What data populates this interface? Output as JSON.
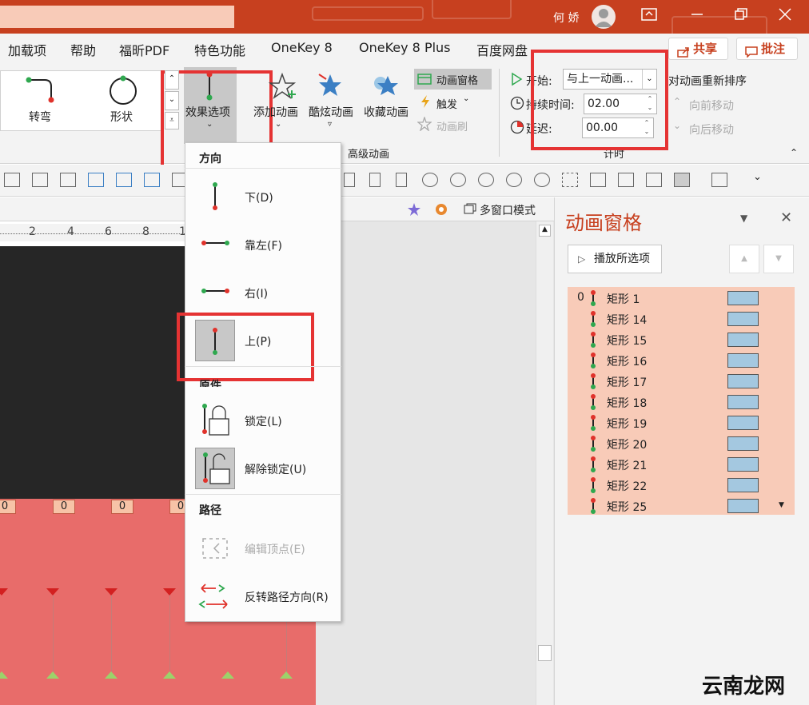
{
  "titlebar": {
    "user_name": "何 娇"
  },
  "menu": {
    "items": [
      "加载项",
      "帮助",
      "福昕PDF",
      "特色功能",
      "OneKey 8",
      "OneKey 8 Plus",
      "百度网盘"
    ],
    "share_label": "共享",
    "comment_label": "批注"
  },
  "ribbon": {
    "path_turn": "转弯",
    "path_shape": "形状",
    "effect_options": "效果选项",
    "add_animation": "添加动画",
    "cool_animation": "酷炫动画",
    "fav_animation": "收藏动画",
    "anim_pane": "动画窗格",
    "trigger": "触发",
    "anim_brush": "动画刷",
    "advanced_group": "高级动画",
    "start_label": "开始:",
    "start_value": "与上一动画...",
    "duration_label": "持续时间:",
    "duration_value": "02.00",
    "delay_label": "延迟:",
    "delay_value": "00.00",
    "reorder_title": "对动画重新排序",
    "move_earlier": "向前移动",
    "move_later": "向后移动",
    "timing_group": "计时"
  },
  "editor": {
    "multi_window": "多窗口模式",
    "ruler_labels": [
      "2",
      "4",
      "6",
      "8",
      "1"
    ],
    "zero_labels": [
      "0",
      "0",
      "0",
      "0",
      "0"
    ]
  },
  "dropdown": {
    "direction_header": "方向",
    "down": "下(D)",
    "left": "靠左(F)",
    "right": "右(I)",
    "up": "上(P)",
    "origin_header": "原件",
    "lock": "锁定(L)",
    "unlock": "解除锁定(U)",
    "path_header": "路径",
    "edit_points": "编辑顶点(E)",
    "reverse_path": "反转路径方向(R)"
  },
  "anim_pane": {
    "title": "动画窗格",
    "play_selected": "播放所选项",
    "items": [
      {
        "num": "0",
        "label": "矩形 1"
      },
      {
        "num": "",
        "label": "矩形 14"
      },
      {
        "num": "",
        "label": "矩形 15"
      },
      {
        "num": "",
        "label": "矩形 16"
      },
      {
        "num": "",
        "label": "矩形 17"
      },
      {
        "num": "",
        "label": "矩形 18"
      },
      {
        "num": "",
        "label": "矩形 19"
      },
      {
        "num": "",
        "label": "矩形 20"
      },
      {
        "num": "",
        "label": "矩形 21"
      },
      {
        "num": "",
        "label": "矩形 22"
      },
      {
        "num": "",
        "label": "矩形 25"
      }
    ]
  },
  "watermark": "云南龙网",
  "colors": {
    "accent": "#c7401f",
    "highlight": "#e53333",
    "list_bg": "#f8cbb8",
    "slide_red": "#e86c6a"
  }
}
